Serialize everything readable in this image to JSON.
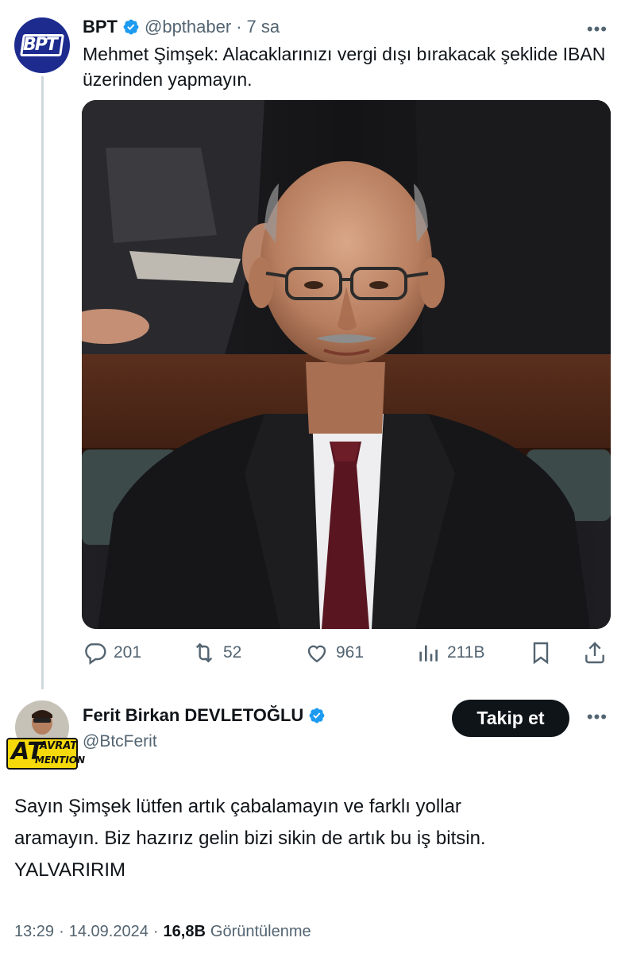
{
  "tweet1": {
    "author_name": "BPT",
    "avatar_text": "BPT",
    "handle": "@bpthaber",
    "separator": "·",
    "time": "7 sa",
    "text": "Mehmet Şimşek: Alacaklarınızı vergi dışı bırakacak şeklide IBAN üzerinden yapmayın.",
    "more_label": "•••",
    "actions": {
      "replies": "201",
      "retweets": "52",
      "likes": "961",
      "views": "211B"
    }
  },
  "tweet2": {
    "author_name": "Ferit Birkan DEVLETOĞLU",
    "handle": "@BtcFerit",
    "avatar_badge_line1": "AVRAT",
    "avatar_badge_big": "AT",
    "avatar_badge_line2": "MENTION",
    "follow_label": "Takip et",
    "more_label": "•••",
    "text_line1": "Sayın Şimşek lütfen artık çabalamayın ve farklı yollar",
    "text_line2": "aramayın. Biz hazırız gelin bizi sikin de artık bu iş bitsin.",
    "text_line3": "YALVARIRIM",
    "time": "13:29",
    "dot": "·",
    "date": "14.09.2024",
    "views_count": "16,8B",
    "views_label": "Görüntülenme"
  },
  "colors": {
    "verified": "#1d9bf0",
    "text": "#0f1419",
    "muted": "#536471",
    "thread_line": "#cfd9de",
    "bpt_avatar": "#1d2b8f",
    "badge_yellow": "#f5d90a"
  },
  "icons": [
    "verified-badge-icon",
    "reply-icon",
    "retweet-icon",
    "like-icon",
    "views-icon",
    "bookmark-icon",
    "share-icon",
    "more-icon"
  ]
}
